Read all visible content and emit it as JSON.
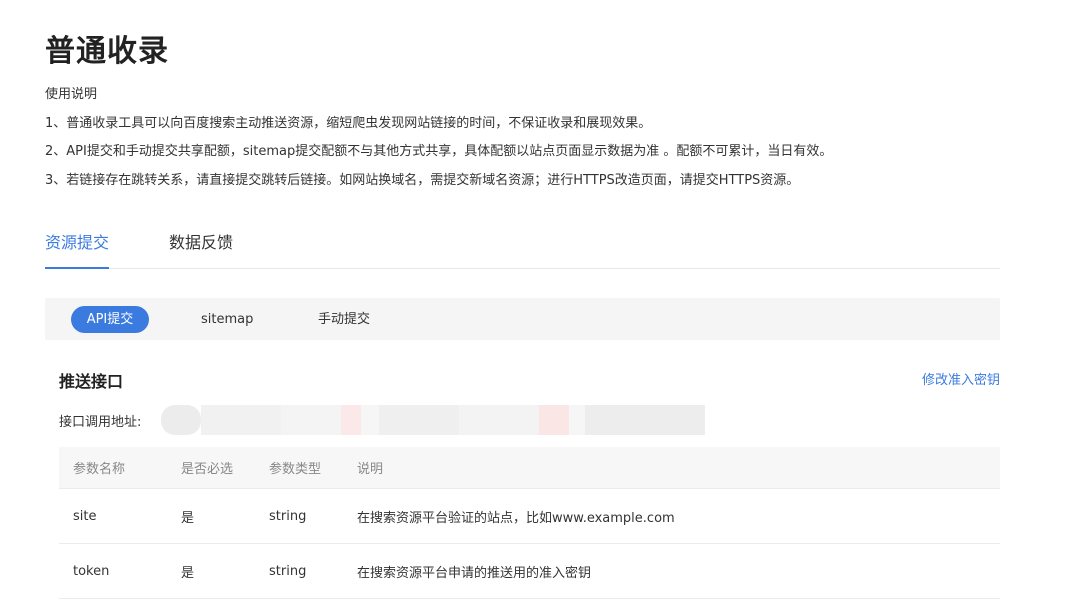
{
  "page": {
    "title": "普通收录"
  },
  "usage": {
    "heading": "使用说明",
    "items": [
      "1、普通收录工具可以向百度搜索主动推送资源，缩短爬虫发现网站链接的时间，不保证收录和展现效果。",
      "2、API提交和手动提交共享配额，sitemap提交配额不与其他方式共享，具体配额以站点页面显示数据为准 。配额不可累计，当日有效。",
      "3、若链接存在跳转关系，请直接提交跳转后链接。如网站换域名，需提交新域名资源；进行HTTPS改造页面，请提交HTTPS资源。"
    ]
  },
  "tabs": [
    {
      "label": "资源提交",
      "active": true
    },
    {
      "label": "数据反馈",
      "active": false
    }
  ],
  "subtabs": [
    {
      "label": "API提交",
      "active": true
    },
    {
      "label": "sitemap",
      "active": false
    },
    {
      "label": "手动提交",
      "active": false
    }
  ],
  "section": {
    "title": "推送接口",
    "modify_link": "修改准入密钥",
    "endpoint_label": "接口调用地址:"
  },
  "params_table": {
    "headers": [
      "参数名称",
      "是否必选",
      "参数类型",
      "说明"
    ],
    "rows": [
      [
        "site",
        "是",
        "string",
        "在搜索资源平台验证的站点，比如www.example.com"
      ],
      [
        "token",
        "是",
        "string",
        "在搜索资源平台申请的推送用的准入密钥"
      ]
    ]
  },
  "colors": {
    "accent": "#3b7be0",
    "text": "#333333",
    "muted": "#888888",
    "panel_bg": "#f5f5f6"
  }
}
